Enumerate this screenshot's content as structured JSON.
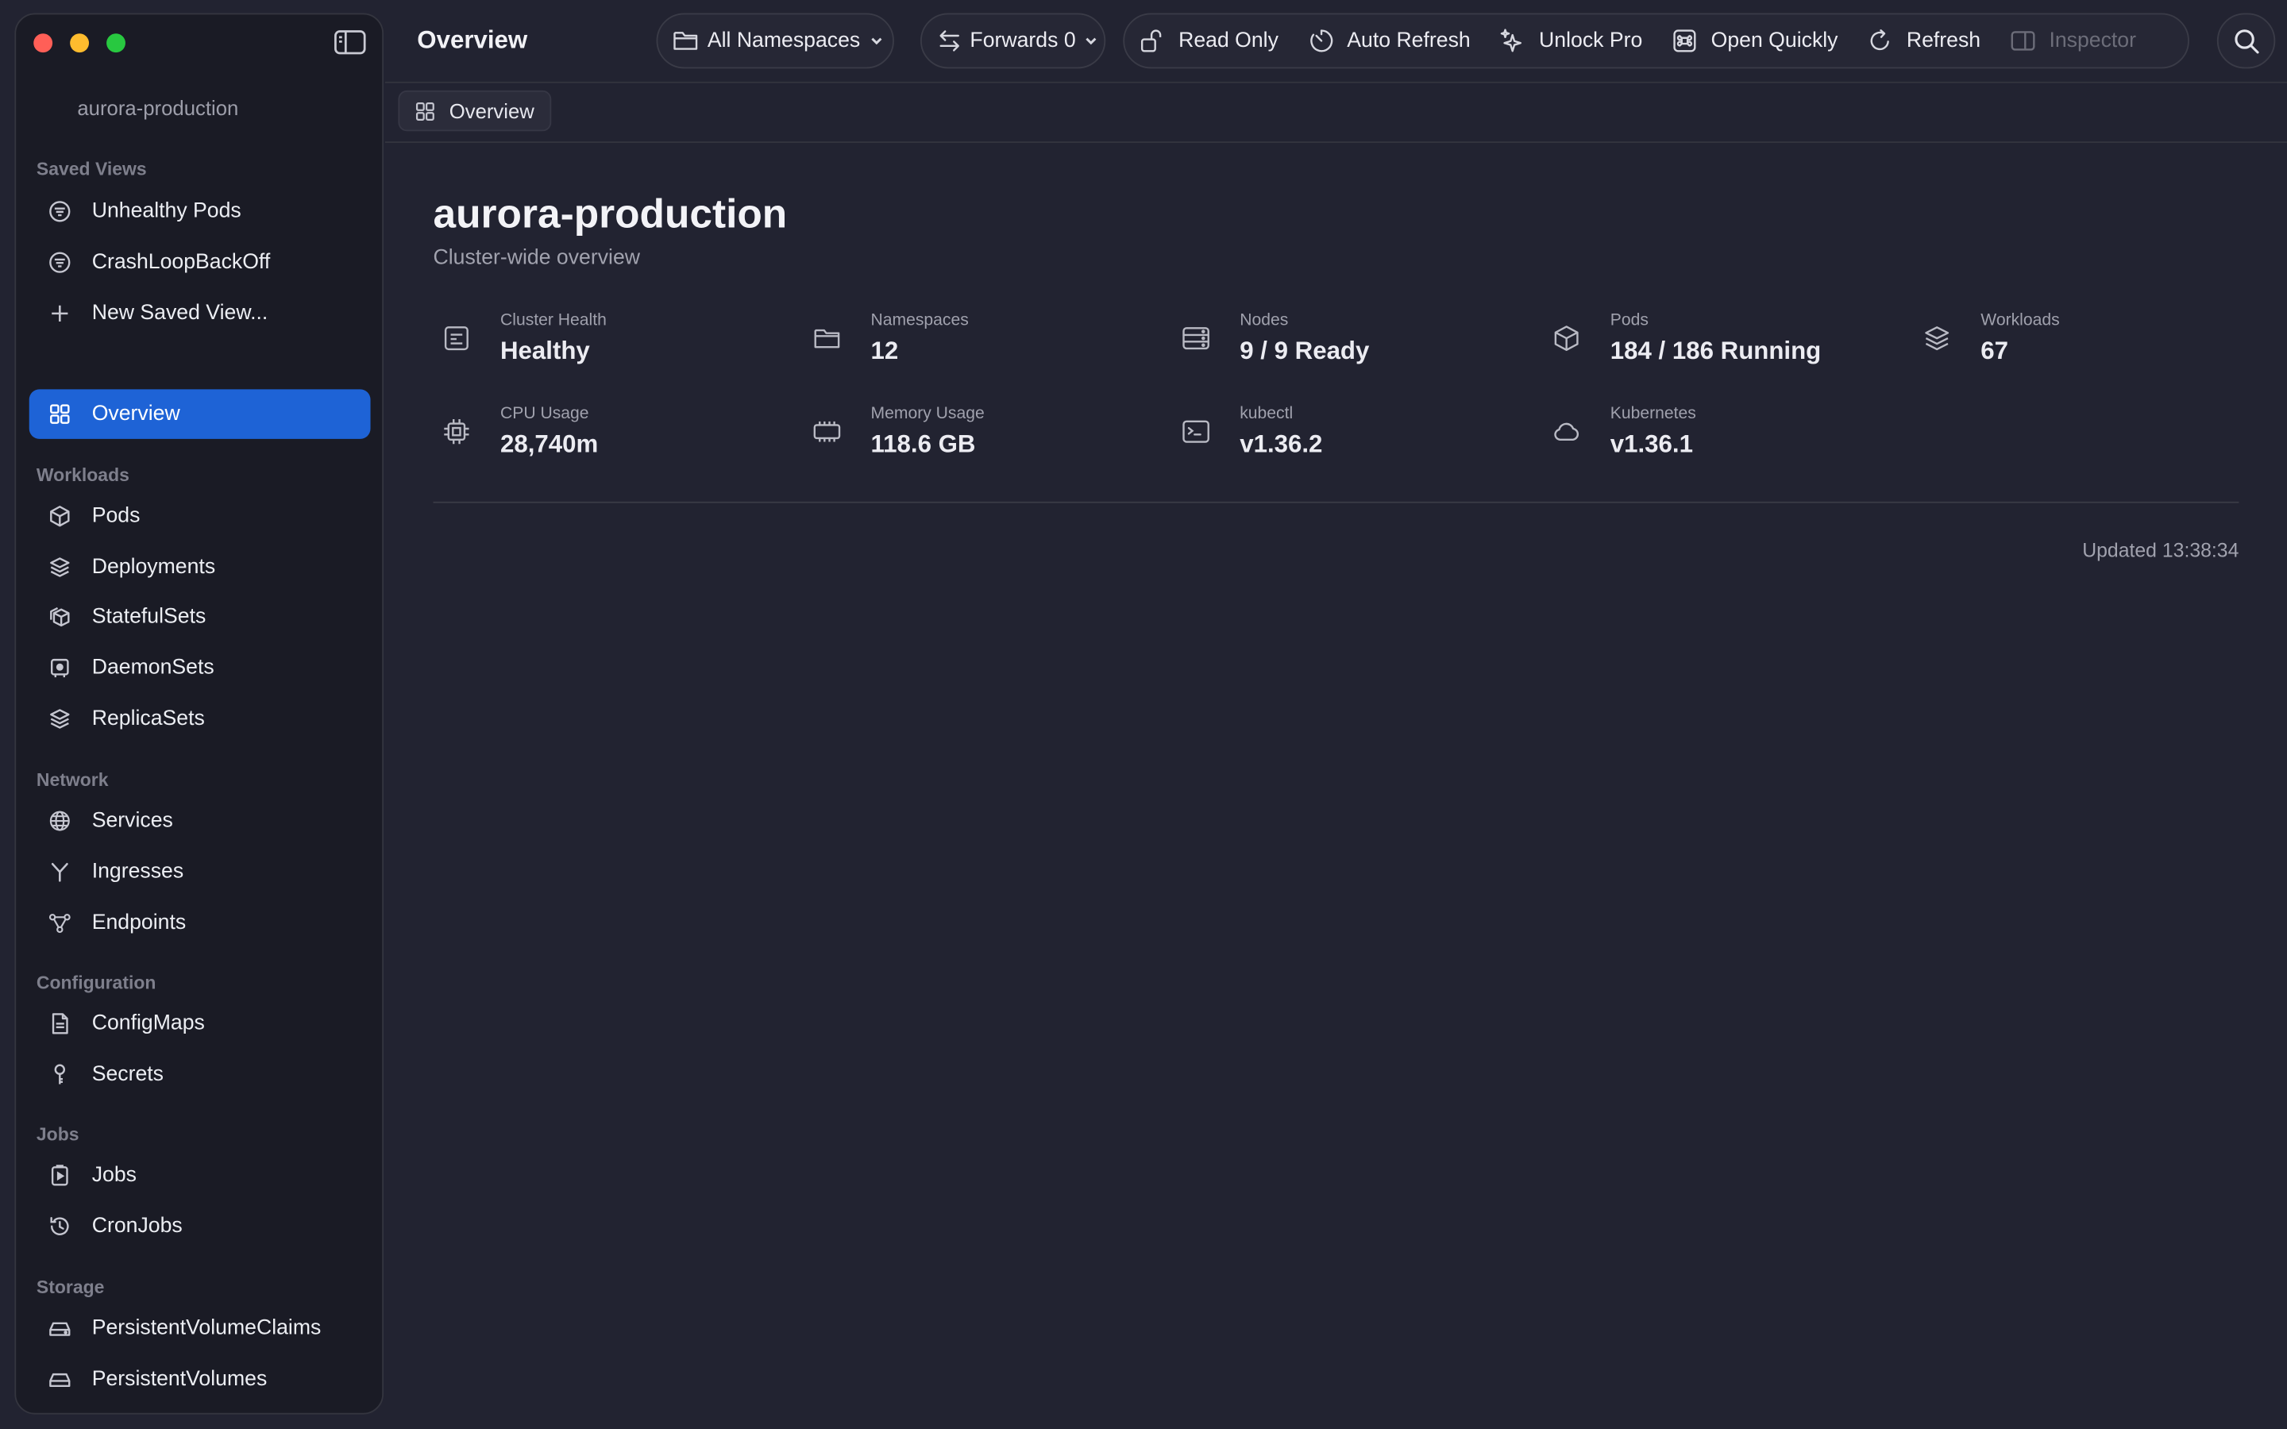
{
  "sidebar": {
    "cluster_name": "aurora-production",
    "sections": {
      "saved_views": "Saved Views",
      "workloads": "Workloads",
      "network": "Network",
      "configuration": "Configuration",
      "jobs": "Jobs",
      "storage": "Storage"
    },
    "items": {
      "unhealthy_pods": "Unhealthy Pods",
      "crashloop": "CrashLoopBackOff",
      "new_saved_view": "New Saved View...",
      "overview": "Overview",
      "pods": "Pods",
      "deployments": "Deployments",
      "statefulsets": "StatefulSets",
      "daemonsets": "DaemonSets",
      "replicasets": "ReplicaSets",
      "services": "Services",
      "ingresses": "Ingresses",
      "endpoints": "Endpoints",
      "configmaps": "ConfigMaps",
      "secrets": "Secrets",
      "jobs": "Jobs",
      "cronjobs": "CronJobs",
      "pvcs": "PersistentVolumeClaims",
      "pvs": "PersistentVolumes"
    }
  },
  "toolbar": {
    "title": "Overview",
    "namespace_select": "All Namespaces",
    "forwards": "Forwards 0",
    "read_only": "Read Only",
    "auto_refresh": "Auto Refresh",
    "unlock_pro": "Unlock Pro",
    "open_quickly": "Open Quickly",
    "refresh": "Refresh",
    "inspector": "Inspector"
  },
  "breadcrumb": {
    "overview": "Overview"
  },
  "main": {
    "heading": "aurora-production",
    "subheading": "Cluster-wide overview",
    "stats": {
      "health": {
        "label": "Cluster Health",
        "value": "Healthy"
      },
      "namespaces": {
        "label": "Namespaces",
        "value": "12"
      },
      "nodes": {
        "label": "Nodes",
        "value": "9 / 9 Ready"
      },
      "pods": {
        "label": "Pods",
        "value": "184 / 186 Running"
      },
      "workloads": {
        "label": "Workloads",
        "value": "67"
      },
      "cpu": {
        "label": "CPU Usage",
        "value": "28,740m"
      },
      "memory": {
        "label": "Memory Usage",
        "value": "118.6 GB"
      },
      "kubectl": {
        "label": "kubectl",
        "value": "v1.36.2"
      },
      "kubernetes": {
        "label": "Kubernetes",
        "value": "v1.36.1"
      }
    },
    "updated": "Updated 13:38:34"
  },
  "colors": {
    "accent": "#1e63d6",
    "background": "#222331",
    "sidebar": "#1a1b25"
  }
}
